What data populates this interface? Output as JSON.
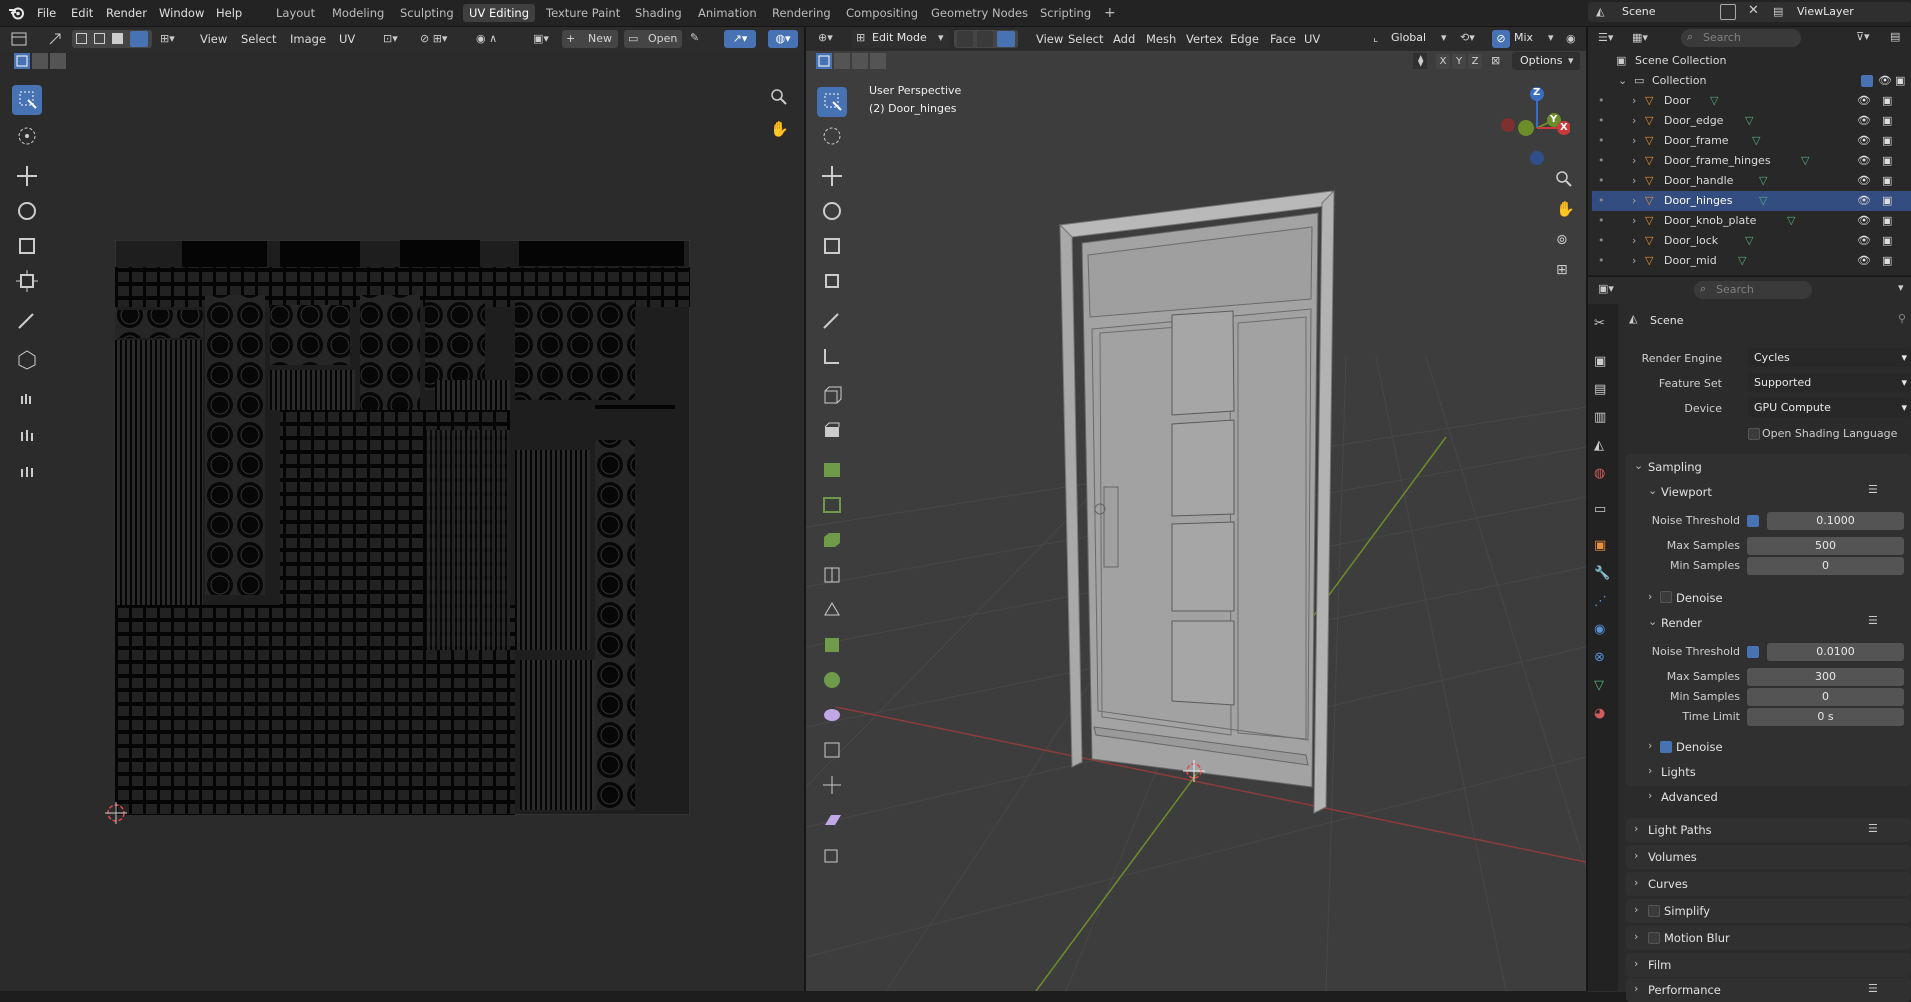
{
  "menu": [
    "File",
    "Edit",
    "Render",
    "Window",
    "Help"
  ],
  "workspaces": [
    "Layout",
    "Modeling",
    "Sculpting",
    "UV Editing",
    "Texture Paint",
    "Shading",
    "Animation",
    "Rendering",
    "Compositing",
    "Geometry Nodes",
    "Scripting"
  ],
  "active_workspace": "UV Editing",
  "scene_name": "Scene",
  "view_layer": "ViewLayer",
  "uv_editor": {
    "menus": [
      "View",
      "Select",
      "Image",
      "UV"
    ],
    "new_label": "New",
    "open_label": "Open"
  },
  "viewport": {
    "mode": "Edit Mode",
    "menus": [
      "View",
      "Select",
      "Add",
      "Mesh",
      "Vertex",
      "Edge",
      "Face",
      "UV"
    ],
    "orientation": "Global",
    "shading_mix": "Mix",
    "overlay_title": "User Perspective",
    "overlay_object": "(2) Door_hinges",
    "axes": [
      "X",
      "Y",
      "Z"
    ],
    "options_label": "Options",
    "gizmo": {
      "z": "Z",
      "y": "Y",
      "x": "X"
    }
  },
  "outliner": {
    "search_placeholder": "Search",
    "scene_collection": "Scene Collection",
    "collection": "Collection",
    "objects": [
      "Door",
      "Door_edge",
      "Door_frame",
      "Door_frame_hinges",
      "Door_handle",
      "Door_hinges",
      "Door_knob_plate",
      "Door_lock",
      "Door_mid"
    ],
    "selected": "Door_hinges"
  },
  "properties": {
    "search_placeholder": "Search",
    "context": "Scene",
    "render_engine_label": "Render Engine",
    "render_engine": "Cycles",
    "feature_set_label": "Feature Set",
    "feature_set": "Supported",
    "device_label": "Device",
    "device": "GPU Compute",
    "osl_label": "Open Shading Language",
    "sampling": "Sampling",
    "viewport": "Viewport",
    "noise_threshold_label": "Noise Threshold",
    "viewport_noise_threshold": "0.1000",
    "max_samples_label": "Max Samples",
    "viewport_max_samples": "500",
    "min_samples_label": "Min Samples",
    "viewport_min_samples": "0",
    "denoise_label": "Denoise",
    "render": "Render",
    "render_noise_threshold": "0.0100",
    "render_max_samples": "300",
    "render_min_samples": "0",
    "time_limit_label": "Time Limit",
    "time_limit": "0 s",
    "lights": "Lights",
    "advanced": "Advanced",
    "light_paths": "Light Paths",
    "volumes": "Volumes",
    "curves": "Curves",
    "simplify": "Simplify",
    "motion_blur": "Motion Blur",
    "film": "Film",
    "performance": "Performance"
  },
  "colors": {
    "accent": "#4772b3",
    "selected_row": "#334d80",
    "x_axis": "#9b3f3f",
    "y_axis": "#6b8d2a",
    "z_axis": "#3a6dc4"
  }
}
